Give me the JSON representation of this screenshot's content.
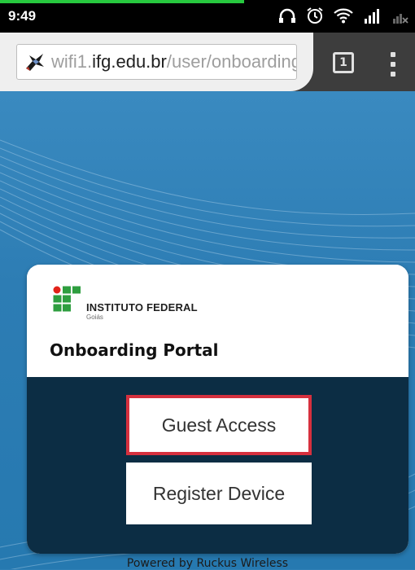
{
  "status_bar": {
    "time": "9:49",
    "icons": [
      "headphones-icon",
      "alarm-icon",
      "wifi-icon",
      "signal-icon",
      "signal-off-icon"
    ]
  },
  "browser": {
    "url_prefix": "wifi1.",
    "url_host": "ifg.edu.br",
    "url_path": "/user/onboarding",
    "tab_count": "1"
  },
  "card": {
    "logo_name": "INSTITUTO FEDERAL",
    "logo_sub": "Goiás",
    "title": "Onboarding Portal",
    "guest_button": "Guest Access",
    "register_button": "Register Device"
  },
  "footer": {
    "text": "Powered by Ruckus Wireless"
  },
  "colors": {
    "accent_red": "#d6303e",
    "panel_dark": "#0c2d44",
    "ifg_green": "#2e9e3f",
    "ifg_red": "#e2231a",
    "background_blue": "#2f7fb5"
  }
}
